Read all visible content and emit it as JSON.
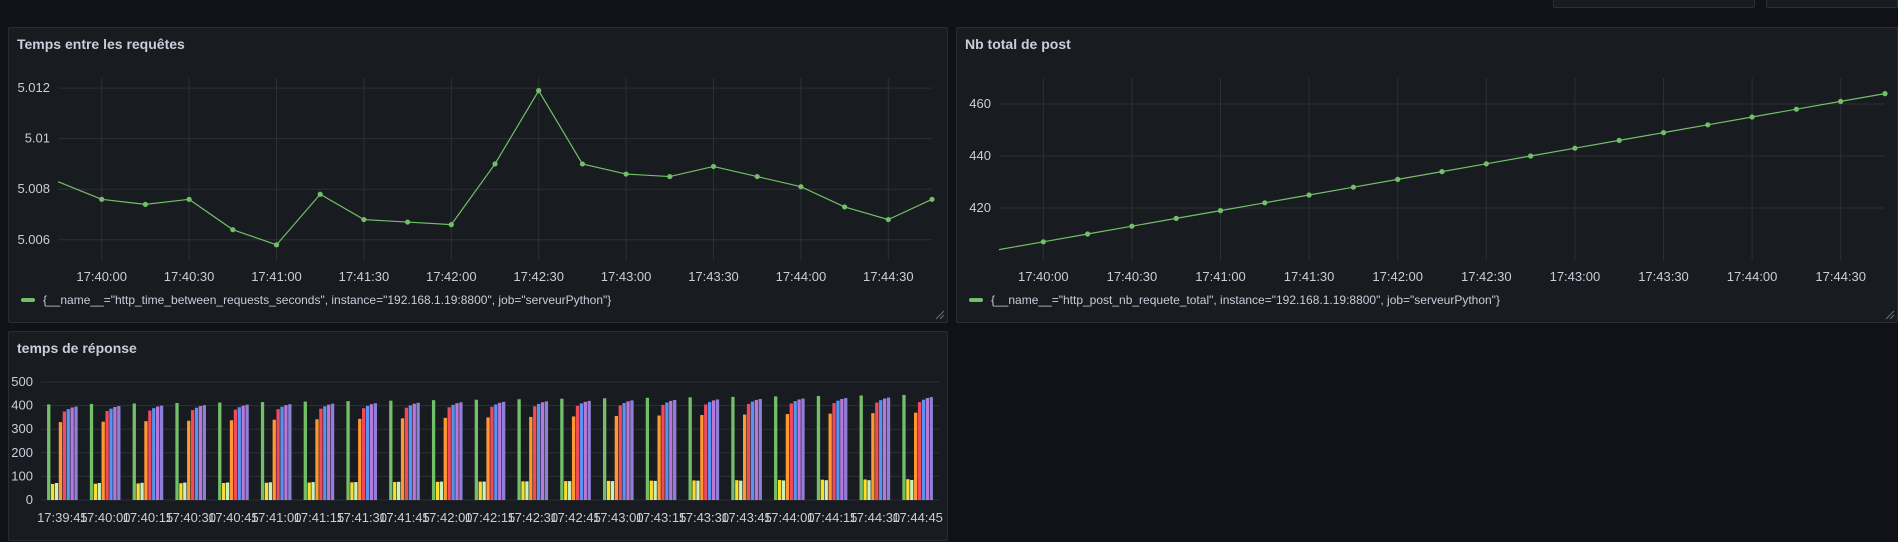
{
  "panels": {
    "time_between": {
      "title": "Temps entre les requêtes",
      "legend": "{__name__=\"http_time_between_requests_seconds\", instance=\"192.168.1.19:8800\", job=\"serveurPython\"}"
    },
    "total_post": {
      "title": "Nb total de post",
      "legend": "{__name__=\"http_post_nb_requete_total\", instance=\"192.168.1.19:8800\", job=\"serveurPython\"}"
    },
    "response_time": {
      "title": "temps de réponse"
    }
  },
  "colors": {
    "series_green": "#73bf69",
    "grid": "#2c3036",
    "bar_colors": [
      "#73bf69",
      "#fade2a",
      "#c8f2c2",
      "#ff9830",
      "#f2495c",
      "#5794f2",
      "#b877d9",
      "#8f7fd9"
    ]
  },
  "chart_data": [
    {
      "type": "line",
      "title": "Temps entre les requêtes",
      "series": [
        {
          "name": "{__name__=\"http_time_between_requests_seconds\", instance=\"192.168.1.19:8800\", job=\"serveurPython\"}",
          "x": [
            "17:39:45",
            "17:40:00",
            "17:40:15",
            "17:40:30",
            "17:40:45",
            "17:41:00",
            "17:41:15",
            "17:41:30",
            "17:41:45",
            "17:42:00",
            "17:42:15",
            "17:42:30",
            "17:42:45",
            "17:43:00",
            "17:43:15",
            "17:43:30",
            "17:43:45",
            "17:44:00",
            "17:44:15",
            "17:44:30",
            "17:44:45"
          ],
          "values": [
            5.0083,
            5.0076,
            5.0074,
            5.0076,
            5.0064,
            5.0058,
            5.0078,
            5.0068,
            5.0067,
            5.0066,
            5.009,
            5.0119,
            5.009,
            5.0086,
            5.0085,
            5.0089,
            5.0085,
            5.0081,
            5.0073,
            5.0068,
            5.0076
          ]
        }
      ],
      "xticks": [
        "17:40:00",
        "17:40:30",
        "17:41:00",
        "17:41:30",
        "17:42:00",
        "17:42:30",
        "17:43:00",
        "17:43:30",
        "17:44:00",
        "17:44:30"
      ],
      "yticks": [
        "5.006",
        "5.008",
        "5.01",
        "5.012"
      ],
      "ylim": [
        5.0052,
        5.0124
      ],
      "grid": true,
      "legend_position": "bottom-left"
    },
    {
      "type": "line",
      "title": "Nb total de post",
      "series": [
        {
          "name": "{__name__=\"http_post_nb_requete_total\", instance=\"192.168.1.19:8800\", job=\"serveurPython\"}",
          "x": [
            "17:39:45",
            "17:40:00",
            "17:40:15",
            "17:40:30",
            "17:40:45",
            "17:41:00",
            "17:41:15",
            "17:41:30",
            "17:41:45",
            "17:42:00",
            "17:42:15",
            "17:42:30",
            "17:42:45",
            "17:43:00",
            "17:43:15",
            "17:43:30",
            "17:43:45",
            "17:44:00",
            "17:44:15",
            "17:44:30",
            "17:44:45"
          ],
          "values": [
            404,
            407,
            410,
            413,
            416,
            419,
            422,
            425,
            428,
            431,
            434,
            437,
            440,
            443,
            446,
            449,
            452,
            455,
            458,
            461,
            464
          ]
        }
      ],
      "xticks": [
        "17:40:00",
        "17:40:30",
        "17:41:00",
        "17:41:30",
        "17:42:00",
        "17:42:30",
        "17:43:00",
        "17:43:30",
        "17:44:00",
        "17:44:30"
      ],
      "yticks": [
        "420",
        "440",
        "460"
      ],
      "ylim": [
        400,
        470
      ],
      "grid": true,
      "legend_position": "bottom-left"
    },
    {
      "type": "bar",
      "title": "temps de réponse",
      "categories": [
        "17:39:45",
        "17:40:00",
        "17:40:15",
        "17:40:30",
        "17:40:45",
        "17:41:00",
        "17:41:15",
        "17:41:30",
        "17:41:45",
        "17:42:00",
        "17:42:15",
        "17:42:30",
        "17:42:45",
        "17:43:00",
        "17:43:15",
        "17:43:30",
        "17:43:45",
        "17:44:00",
        "17:44:15",
        "17:44:30",
        "17:44:45"
      ],
      "series": [
        {
          "values": [
            405,
            407,
            409,
            411,
            413,
            415,
            417,
            419,
            421,
            423,
            425,
            427,
            429,
            431,
            433,
            435,
            437,
            439,
            441,
            443,
            445
          ]
        },
        {
          "values": [
            68,
            69,
            70,
            71,
            72,
            73,
            74,
            75,
            76,
            77,
            78,
            79,
            80,
            81,
            82,
            83,
            84,
            85,
            86,
            87,
            88
          ]
        },
        {
          "values": [
            72,
            72,
            73,
            74,
            74,
            75,
            76,
            76,
            77,
            78,
            78,
            79,
            80,
            80,
            81,
            82,
            82,
            83,
            84,
            84,
            85
          ]
        },
        {
          "values": [
            330,
            332,
            334,
            336,
            338,
            340,
            342,
            344,
            346,
            348,
            350,
            352,
            354,
            356,
            358,
            360,
            362,
            364,
            366,
            368,
            370
          ]
        },
        {
          "values": [
            375,
            377,
            379,
            381,
            383,
            385,
            387,
            389,
            391,
            393,
            395,
            397,
            399,
            401,
            403,
            405,
            407,
            409,
            411,
            413,
            415
          ]
        },
        {
          "values": [
            385,
            387,
            389,
            391,
            393,
            395,
            397,
            399,
            401,
            403,
            405,
            407,
            409,
            411,
            413,
            415,
            417,
            419,
            421,
            423,
            425
          ]
        },
        {
          "values": [
            392,
            394,
            396,
            398,
            400,
            402,
            404,
            406,
            408,
            410,
            412,
            414,
            416,
            418,
            420,
            422,
            424,
            426,
            428,
            430,
            432
          ]
        },
        {
          "values": [
            396,
            398,
            400,
            402,
            404,
            406,
            408,
            410,
            412,
            414,
            416,
            418,
            420,
            422,
            424,
            426,
            428,
            430,
            432,
            434,
            436
          ]
        }
      ],
      "yticks": [
        "0",
        "100",
        "200",
        "300",
        "400",
        "500"
      ],
      "ylim": [
        0,
        500
      ],
      "grid": true
    }
  ]
}
